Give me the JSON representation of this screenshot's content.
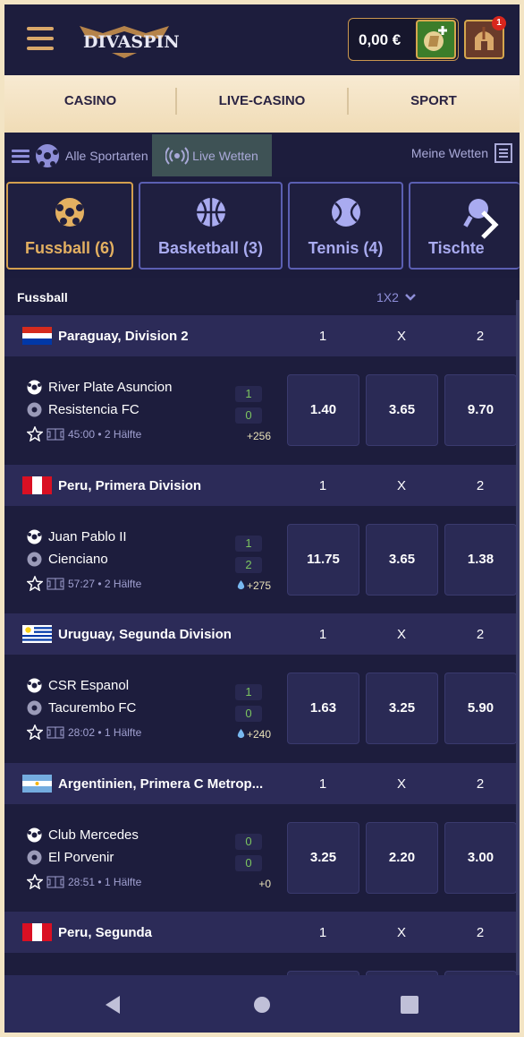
{
  "header": {
    "logo_text": "DIVASPIN",
    "balance": "0,00 €",
    "profile_badge": "1"
  },
  "main_nav": [
    "CASINO",
    "LIVE-CASINO",
    "SPORT"
  ],
  "toolbar": {
    "all_sports": "Alle Sportarten",
    "live_bets": "Live Wetten",
    "my_bets": "Meine Wetten"
  },
  "sport_tabs": [
    {
      "label": "Fussball (6)",
      "icon": "soccer-icon",
      "active": true
    },
    {
      "label": "Basketball (3)",
      "icon": "basketball-icon",
      "active": false
    },
    {
      "label": "Tennis (4)",
      "icon": "tennis-icon",
      "active": false
    },
    {
      "label": "Tischte",
      "icon": "table-tennis-icon",
      "active": false
    }
  ],
  "section": {
    "title": "Fussball",
    "market": "1X2"
  },
  "odds_headers": [
    "1",
    "X",
    "2"
  ],
  "leagues": [
    {
      "name": "Paraguay, Division 2",
      "flag": "paraguay",
      "match": {
        "home": "River Plate Asuncion",
        "away": "Resistencia FC",
        "home_score": "1",
        "away_score": "0",
        "time": "45:00 • 2 Hälfte",
        "more": "+256",
        "more_icon": "",
        "odds": [
          "1.40",
          "3.65",
          "9.70"
        ]
      }
    },
    {
      "name": "Peru, Primera Division",
      "flag": "peru",
      "match": {
        "home": "Juan Pablo II",
        "away": "Cienciano",
        "home_score": "1",
        "away_score": "2",
        "time": "57:27 • 2 Hälfte",
        "more": "+275",
        "more_icon": "drop-icon",
        "odds": [
          "11.75",
          "3.65",
          "1.38"
        ]
      }
    },
    {
      "name": "Uruguay, Segunda Division",
      "flag": "uruguay",
      "match": {
        "home": "CSR Espanol",
        "away": "Tacurembo FC",
        "home_score": "1",
        "away_score": "0",
        "time": "28:02 • 1 Hälfte",
        "more": "+240",
        "more_icon": "drop-icon",
        "odds": [
          "1.63",
          "3.25",
          "5.90"
        ]
      }
    },
    {
      "name": "Argentinien, Primera C Metrop...",
      "flag": "argentina",
      "match": {
        "home": "Club Mercedes",
        "away": "El Porvenir",
        "home_score": "0",
        "away_score": "0",
        "time": "28:51 • 1 Hälfte",
        "more": "+0",
        "more_icon": "",
        "odds": [
          "3.25",
          "2.20",
          "3.00"
        ]
      }
    },
    {
      "name": "Peru, Segunda",
      "flag": "peru"
    }
  ],
  "colors": {
    "accent_gold": "#d39f4e",
    "bg_dark": "#1d1d3d",
    "league_bg": "#2c2b58",
    "tab_border": "#5b5fb2",
    "score_green": "#7cc560"
  }
}
